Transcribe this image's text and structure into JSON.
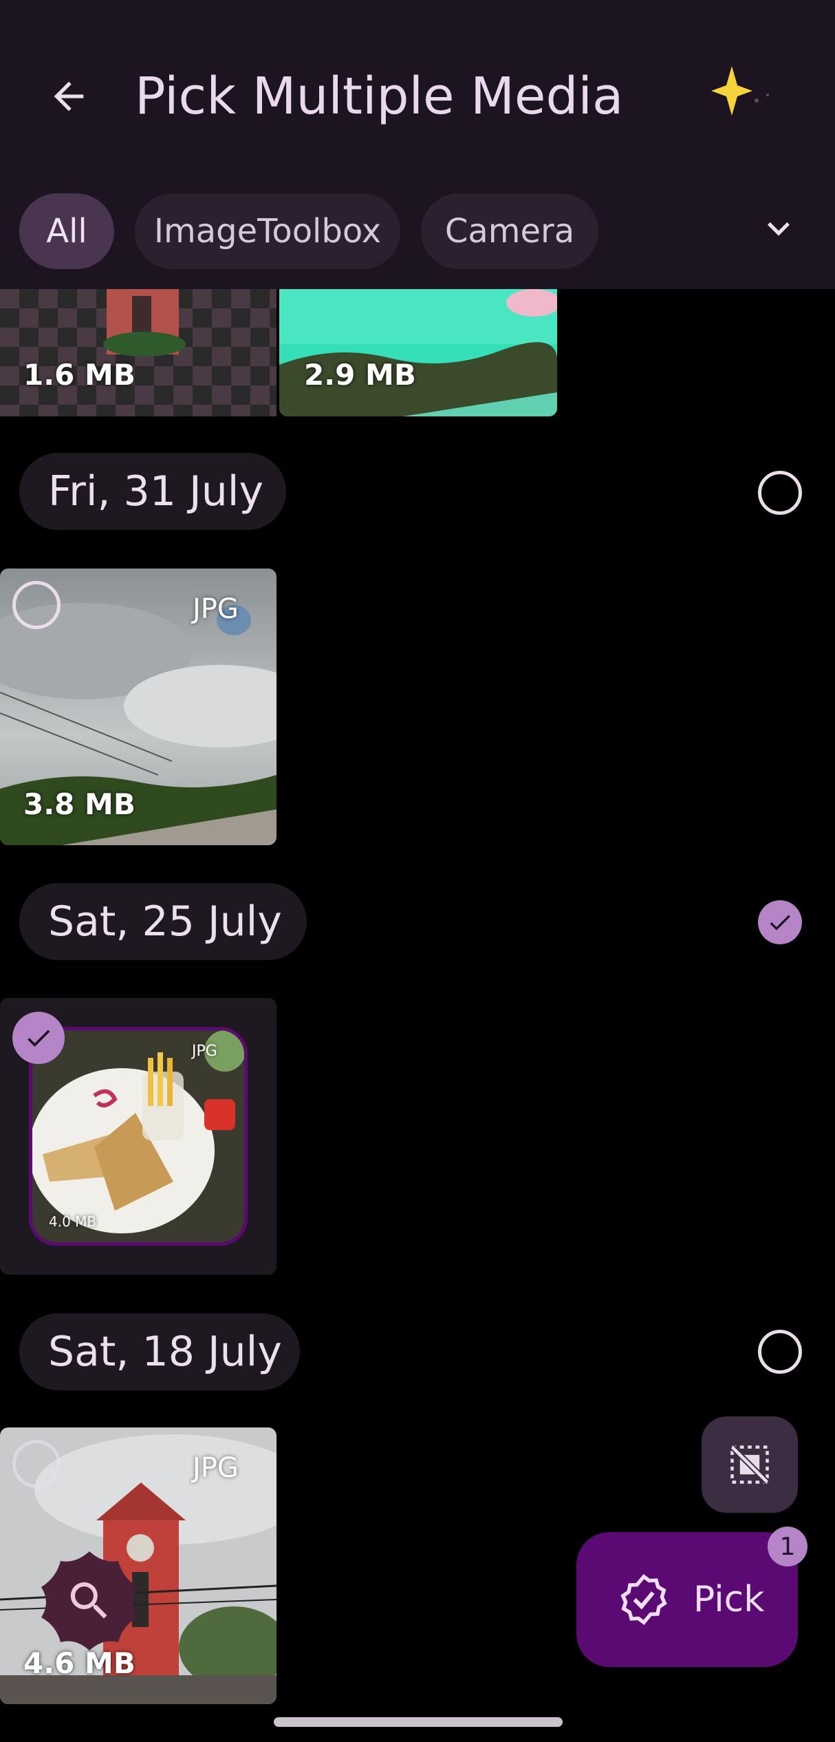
{
  "header": {
    "title": "Pick Multiple Media",
    "back_icon": "arrow-left-icon",
    "action_icon": "sparkle-icon"
  },
  "filters": {
    "chips": [
      "All",
      "ImageToolbox",
      "Camera"
    ],
    "selected": "All",
    "expand_icon": "chevron-down-icon"
  },
  "top_row": {
    "items": [
      {
        "size": "1.6 MB"
      },
      {
        "size": "2.9 MB"
      }
    ]
  },
  "groups": [
    {
      "date": "Fri, 31 July",
      "selected": false,
      "items": [
        {
          "type": "JPG",
          "size": "3.8 MB",
          "selected": false
        }
      ]
    },
    {
      "date": "Sat, 25 July",
      "selected": true,
      "items": [
        {
          "type": "JPG",
          "size": "4.0 MB",
          "selected": true
        }
      ]
    },
    {
      "date": "Sat, 18 July",
      "selected": false,
      "items": [
        {
          "type": "JPG",
          "size": "4.6 MB",
          "selected": false
        }
      ]
    }
  ],
  "fab": {
    "pick_label": "Pick",
    "pick_count": "1",
    "pick_icon": "verified-check-icon",
    "deselect_icon": "deselect-icon",
    "search_icon": "search-icon"
  },
  "colors": {
    "accent": "#b585c8",
    "fab_bg": "#5b0a73",
    "topbar_bg": "#1c1420",
    "chip_selected": "#4a3550"
  }
}
